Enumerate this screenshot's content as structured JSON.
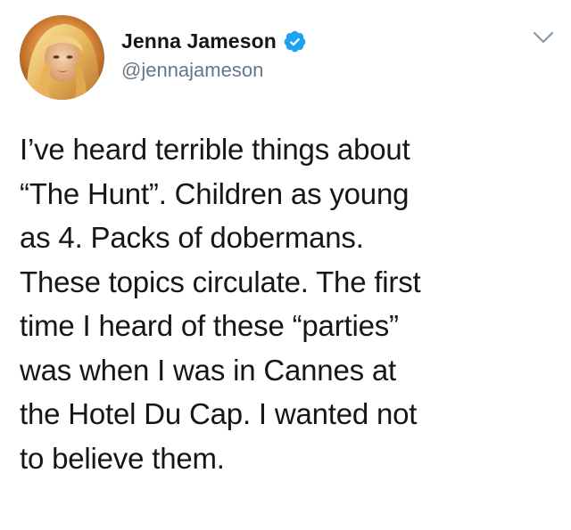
{
  "tweet": {
    "author": {
      "display_name": "Jenna Jameson",
      "handle": "@jennajameson",
      "verified": true,
      "avatar_icon": "profile-photo"
    },
    "menu_icon": "chevron-down-icon",
    "text_lines": [
      "I’ve heard terrible things about",
      "“The Hunt”. Children as young",
      "as 4. Packs of dobermans.",
      "These topics circulate. The first",
      "time I heard of these “parties”",
      "was when I was in Cannes at",
      "the Hotel Du Cap. I wanted not",
      "to believe them."
    ]
  },
  "colors": {
    "text": "#14171a",
    "secondary": "#657786",
    "verified_badge": "#1da1f2",
    "chevron": "#8899a6"
  }
}
